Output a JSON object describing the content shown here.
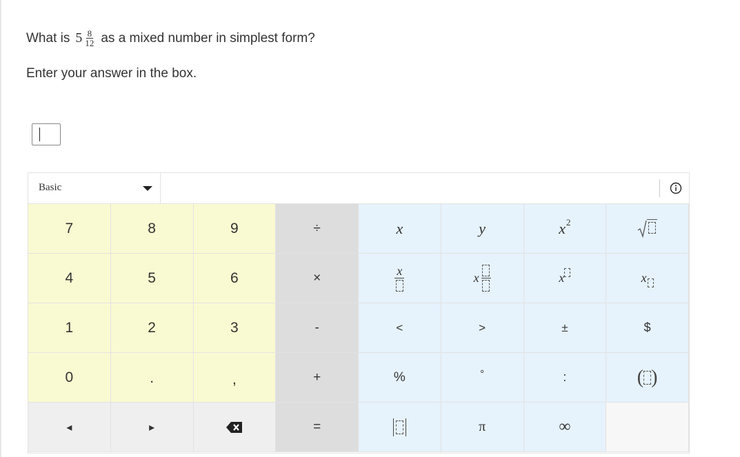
{
  "question": {
    "prefix": "What is",
    "whole": "5",
    "numerator": "8",
    "denominator": "12",
    "suffix": "as a mixed number in simplest form?"
  },
  "instruction": "Enter your answer in the box.",
  "keypad": {
    "mode": "Basic",
    "keys": {
      "seven": "7",
      "eight": "8",
      "nine": "9",
      "divide": "÷",
      "x": "x",
      "y": "y",
      "x_sq_base": "x",
      "x_sq_exp": "2",
      "four": "4",
      "five": "5",
      "six": "6",
      "multiply": "×",
      "frac_x": "x",
      "mixed_x": "x",
      "pow_x": "x",
      "sub_x": "x",
      "one": "1",
      "two": "2",
      "three": "3",
      "minus": "-",
      "lt": "<",
      "gt": ">",
      "plusminus": "±",
      "dollar": "$",
      "zero": "0",
      "decimal": ".",
      "comma": ",",
      "plus": "+",
      "percent": "%",
      "degree": "°",
      "colon": ":",
      "left": "◂",
      "right": "▸",
      "equals": "=",
      "pi": "π",
      "infinity": "∞"
    }
  }
}
